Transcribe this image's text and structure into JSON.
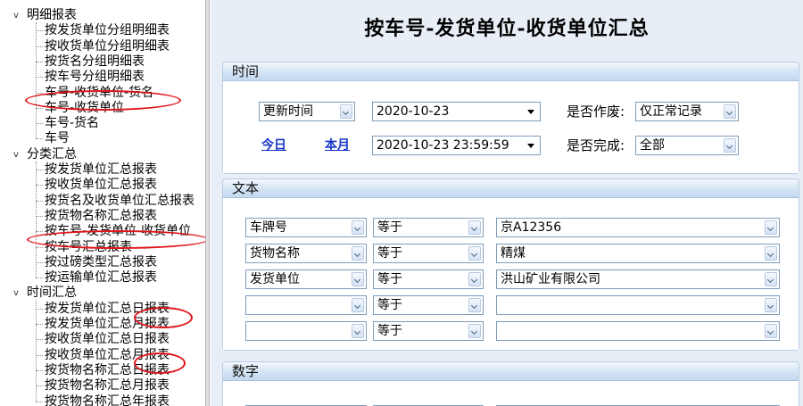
{
  "tree": [
    {
      "id": "mx",
      "label": "明细报表",
      "kind": "folder"
    },
    {
      "label": "按发货单位分组明细表",
      "kind": "leaf"
    },
    {
      "label": "按收货单位分组明细表",
      "kind": "leaf"
    },
    {
      "label": "按货名分组明细表",
      "kind": "leaf"
    },
    {
      "label": "按车号分组明细表",
      "kind": "leaf"
    },
    {
      "label": "车号-收货单位-货名",
      "kind": "leaf"
    },
    {
      "label": "车号-收货单位",
      "kind": "leaf"
    },
    {
      "label": "车号-货名",
      "kind": "leaf"
    },
    {
      "label": "车号",
      "kind": "leaf"
    },
    {
      "id": "fl",
      "label": "分类汇总",
      "kind": "folder"
    },
    {
      "label": "按发货单位汇总报表",
      "kind": "leaf"
    },
    {
      "label": "按收货单位汇总报表",
      "kind": "leaf"
    },
    {
      "label": "按货名及收货单位汇总报表",
      "kind": "leaf"
    },
    {
      "label": "按货物名称汇总报表",
      "kind": "leaf"
    },
    {
      "label": "按车号-发货单位-收货单位",
      "kind": "leaf"
    },
    {
      "label": "按车号汇总报表",
      "kind": "leaf"
    },
    {
      "label": "按过磅类型汇总报表",
      "kind": "leaf"
    },
    {
      "label": "按运输单位汇总报表",
      "kind": "leaf"
    },
    {
      "id": "sj",
      "label": "时间汇总",
      "kind": "folder"
    },
    {
      "label": "按发货单位汇总日报表",
      "kind": "leaf"
    },
    {
      "label": "按发货单位汇总月报表",
      "kind": "leaf"
    },
    {
      "label": "按收货单位汇总日报表",
      "kind": "leaf"
    },
    {
      "label": "按收货单位汇总月报表",
      "kind": "leaf"
    },
    {
      "label": "按货物名称汇总日报表",
      "kind": "leaf"
    },
    {
      "label": "按货物名称汇总月报表",
      "kind": "leaf"
    },
    {
      "label": "按货物名称汇总年报表",
      "kind": "leaf"
    }
  ],
  "toggle_glyph": "v",
  "title": "按车号-发货单位-收货单位汇总",
  "time_group": {
    "header": "时间",
    "time_type": "更新时间",
    "start_date": "2020-10-23",
    "end_date": "2020-10-23 23:59:59",
    "today_link": "今日",
    "month_link": "本月",
    "void_label": "是否作废:",
    "void_value": "仅正常记录",
    "done_label": "是否完成:",
    "done_value": "全部"
  },
  "text_group": {
    "header": "文本",
    "rows": [
      {
        "field": "车牌号",
        "op": "等于",
        "value": "京A12356"
      },
      {
        "field": "货物名称",
        "op": "等于",
        "value": "精煤"
      },
      {
        "field": "发货单位",
        "op": "等于",
        "value": "洪山矿业有限公司"
      },
      {
        "field": "",
        "op": "等于",
        "value": ""
      },
      {
        "field": "",
        "op": "等于",
        "value": ""
      }
    ]
  },
  "number_group": {
    "header": "数字"
  },
  "colors": {
    "annotation": "#e0141b",
    "link": "#1636c8",
    "panel": "#e8eef6"
  }
}
